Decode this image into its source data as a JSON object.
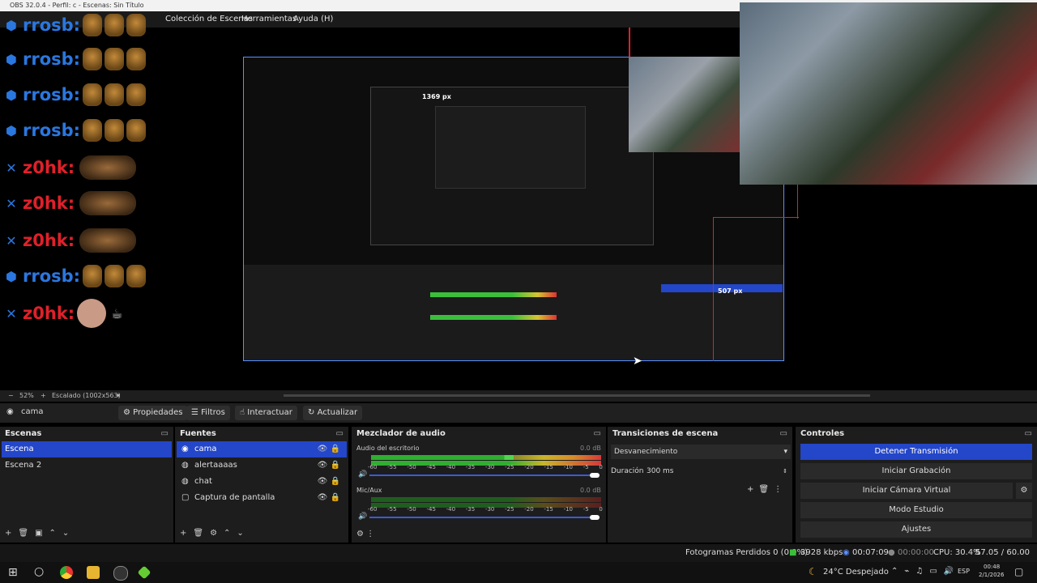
{
  "window": {
    "title": "OBS 32.0.4 - Perfil: c - Escenas: Sin Título"
  },
  "menu": {
    "items": [
      "Colección de Escenas",
      "Herramientas",
      "Ayuda (H)"
    ]
  },
  "chat": {
    "lines": [
      {
        "user": "rrosb:",
        "color": "#2a77e0"
      },
      {
        "user": "rrosb:",
        "color": "#2a77e0"
      },
      {
        "user": "rrosb:",
        "color": "#2a77e0"
      },
      {
        "user": "rrosb:",
        "color": "#2a77e0"
      },
      {
        "user": "z0hk:",
        "color": "#e0202a"
      },
      {
        "user": "z0hk:",
        "color": "#e0202a"
      },
      {
        "user": "z0hk:",
        "color": "#e0202a"
      },
      {
        "user": "rrosb:",
        "color": "#2a77e0"
      },
      {
        "user": "z0hk:",
        "color": "#e0202a"
      }
    ]
  },
  "preview": {
    "measure_top": "1369 px",
    "measure_right": "507 px",
    "zoom_label": "52%",
    "scale_label": "Escalado (1002x563)"
  },
  "toolbar": {
    "source_name": "cama",
    "properties": "Propiedades",
    "filters": "Filtros",
    "interact": "Interactuar",
    "refresh": "Actualizar"
  },
  "scenes": {
    "title": "Escenas",
    "items": [
      "Escena",
      "Escena 2"
    ]
  },
  "sources": {
    "title": "Fuentes",
    "items": [
      {
        "label": "cama",
        "icon": "camera-icon"
      },
      {
        "label": "alertaaaas",
        "icon": "browser-icon"
      },
      {
        "label": "chat",
        "icon": "browser-icon"
      },
      {
        "label": "Captura de pantalla",
        "icon": "monitor-icon"
      }
    ]
  },
  "mixer": {
    "title": "Mezclador de audio",
    "channels": [
      {
        "name": "Audio del escritorio",
        "level": "0.0 dB",
        "volume": 0.98
      },
      {
        "name": "Mic/Aux",
        "level": "0.0 dB",
        "volume": 0.98
      }
    ],
    "scale": [
      "-60",
      "-55",
      "-50",
      "-45",
      "-40",
      "-35",
      "-30",
      "-25",
      "-20",
      "-15",
      "-10",
      "-5",
      "0"
    ]
  },
  "transitions": {
    "title": "Transiciones de escena",
    "selected": "Desvanecimiento",
    "duration_label": "Duración",
    "duration_value": "300 ms"
  },
  "controls": {
    "title": "Controles",
    "stop_stream": "Detener Transmisión",
    "start_recording": "Iniciar Grabación",
    "start_virtualcam": "Iniciar Cámara Virtual",
    "studio_mode": "Modo Estudio",
    "settings": "Ajustes"
  },
  "status": {
    "dropped": "Fotogramas Perdidos 0 (0.0%)",
    "bitrate": "3928 kbps",
    "stream_time": "00:07:09",
    "rec_time": "00:00:00",
    "cpu": "CPU: 30.4%",
    "fps": "57.05 / 60.00 FPS"
  },
  "taskbar": {
    "weather": "24°C  Despejado",
    "lang": "ESP",
    "time": "00:48",
    "date": "2/1/2026"
  },
  "colors": {
    "accent": "#2446c8",
    "red": "#e0202a",
    "blue_user": "#2a77e0"
  }
}
